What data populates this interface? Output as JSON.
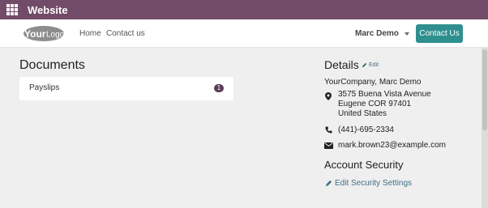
{
  "appbar": {
    "title": "Website"
  },
  "navbar": {
    "logo_text": "YourLogo",
    "links": [
      "Home",
      "Contact us"
    ],
    "user": "Marc Demo",
    "contact_button": "Contact Us"
  },
  "documents": {
    "title": "Documents",
    "items": [
      {
        "label": "Payslips",
        "count": "1"
      }
    ]
  },
  "details": {
    "title": "Details",
    "edit_label": "Edit",
    "company": "YourCompany, Marc Demo",
    "address": [
      "3575 Buena Vista Avenue",
      "Eugene COR 97401",
      "United States"
    ],
    "phone": "(441)-695-2334",
    "email": "mark.brown23@example.com"
  },
  "security": {
    "title": "Account Security",
    "edit_link": "Edit Security Settings"
  },
  "colors": {
    "appbar": "#714b67",
    "primary_button": "#2f8f8f",
    "badge": "#5c3b54",
    "content_bg": "#efefef"
  }
}
